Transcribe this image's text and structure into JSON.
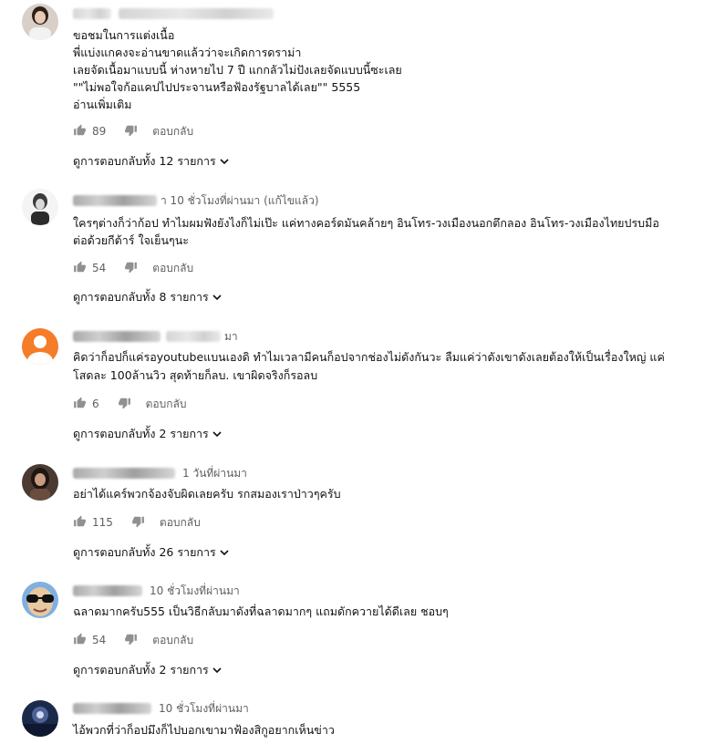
{
  "labels": {
    "reply": "ตอบกลับ",
    "read_more": "อ่านเพิ่มเติม"
  },
  "comments": [
    {
      "time": "",
      "lines": [
        "ขอชมในการแต่งเนื้อ",
        "พี่แบ่งแกคงจะอ่านขาดแล้วว่าจะเกิดการดราม่า",
        "เลยจัดเนื้อมาแบบนี้ ห่างหายไป 7 ปี แกกลัวไม่ปังเลยจัดแบบนี้ซะเลย",
        "\"\"ไม่พอใจก้อแคปไปประจานหรือฟ้องรัฐบาลได้เลย\"\"  5555"
      ],
      "likes": "89",
      "view_replies": "ดูการตอบกลับทั้ง 12 รายการ"
    },
    {
      "time": "า 10 ชั่วโมงที่ผ่านมา (แก้ไขแล้ว)",
      "lines": [
        "ใครๆต่างก็ว่าก้อป ทำไมผมฟังยังไงก็ไม่เป๊ะ แค่ทางคอร์ดมันคล้ายๆ อินโทร-วงเมืองนอกตึกลอง อินโทร-วงเมืองไทยปรบมือ",
        "ต่อด้วยกีต้าร์ ใจเย็นๆนะ"
      ],
      "likes": "54",
      "view_replies": "ดูการตอบกลับทั้ง 8 รายการ"
    },
    {
      "time": "มา",
      "lines": [
        "คิดว่าก็อปก็แค่รอyoutubeแบนเองดิ ทำไมเวลามีคนก็อปจากช่องไม่ดังกันวะ ลืมแค่ว่าดังเขาดังเลยต้องให้เป็นเรื่องใหญ่ แค่",
        "โสดละ 100ล้านวิว สุดท้ายก็ลบ. เขาผิดจริงก็รอลบ"
      ],
      "likes": "6",
      "view_replies": "ดูการตอบกลับทั้ง 2 รายการ"
    },
    {
      "time": "1 วันที่ผ่านมา",
      "lines": [
        "อย่าได้แคร์พวกจ้องจับผิดเลยครับ รกสมองเราป่าวๆครับ"
      ],
      "likes": "115",
      "view_replies": "ดูการตอบกลับทั้ง 26 รายการ"
    },
    {
      "time": "10 ชั่วโมงที่ผ่านมา",
      "lines": [
        "ฉลาดมากครับ555 เป็นวิธีกลับมาดังที่ฉลาดมากๆ แถมดักควายได้ดีเลย ชอบๆ"
      ],
      "likes": "54",
      "view_replies": "ดูการตอบกลับทั้ง 2 รายการ"
    },
    {
      "time": "10 ชั่วโมงที่ผ่านมา",
      "lines": [
        "ไอ้พวกที่ว่าก็อปมึงก็ไปบอกเขามาฟ้องสิกูอยากเห็นข่าว"
      ]
    }
  ]
}
